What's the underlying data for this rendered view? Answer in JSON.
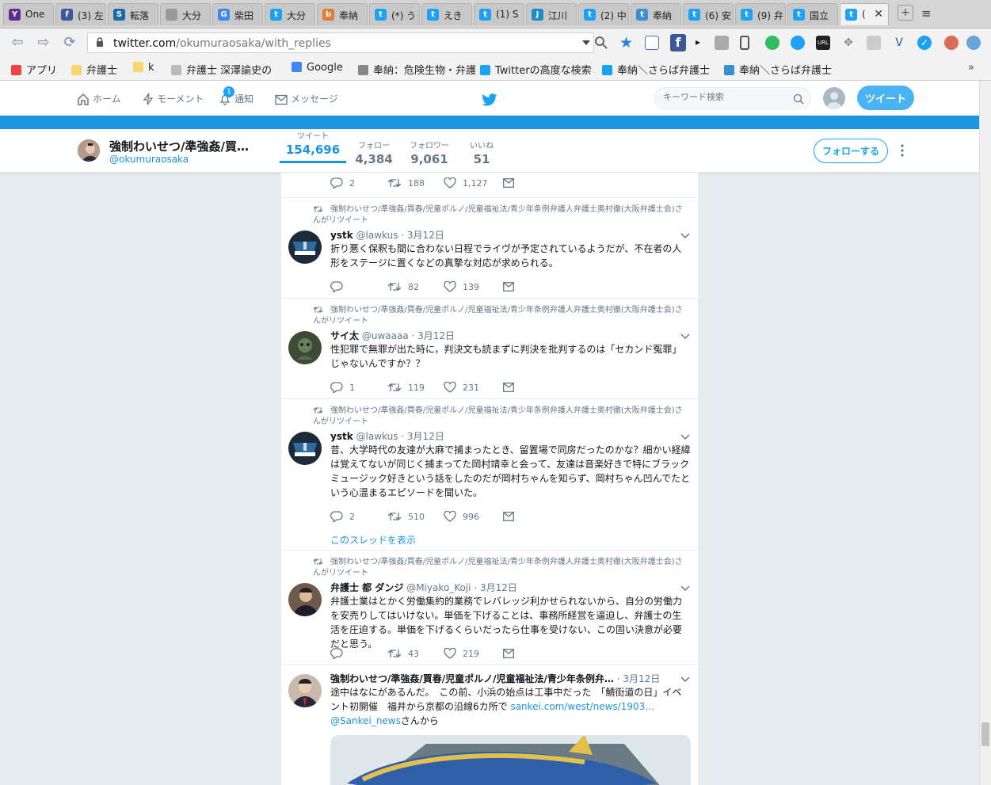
{
  "browser": {
    "tabs": [
      {
        "label": "One",
        "icon": "Y",
        "color": "#5b2d90"
      },
      {
        "label": "(3) 左",
        "icon": "f",
        "color": "#3b5998"
      },
      {
        "label": "転落",
        "icon": "S",
        "color": "#1a6aa8"
      },
      {
        "label": "大分",
        "icon": "",
        "color": "#999999"
      },
      {
        "label": "柴田",
        "icon": "G",
        "color": "#4285f4"
      },
      {
        "label": "大分",
        "icon": "t",
        "color": "#1da1f2"
      },
      {
        "label": "奉納",
        "icon": "b",
        "color": "#e07b39"
      },
      {
        "label": "(*) う",
        "icon": "t",
        "color": "#1da1f2"
      },
      {
        "label": "えき",
        "icon": "t",
        "color": "#1da1f2"
      },
      {
        "label": "(1) S",
        "icon": "t",
        "color": "#1da1f2"
      },
      {
        "label": "江川",
        "icon": "J",
        "color": "#1b8cc4"
      },
      {
        "label": "(2) 中",
        "icon": "t",
        "color": "#1da1f2"
      },
      {
        "label": "奉納",
        "icon": "t",
        "color": "#3a8fd0"
      },
      {
        "label": "(6) 安",
        "icon": "t",
        "color": "#1da1f2"
      },
      {
        "label": "(9) 弁",
        "icon": "t",
        "color": "#1da1f2"
      },
      {
        "label": "国立",
        "icon": "t",
        "color": "#1da1f2"
      },
      {
        "label": "(",
        "icon": "t",
        "color": "#1da1f2"
      }
    ],
    "url_domain": "twitter.com",
    "url_path": "/okumuraosaka/with_replies",
    "bookmarks": [
      {
        "label": "アプリ",
        "color": "#e44"
      },
      {
        "label": "弁護士",
        "color": "#f5d76e"
      },
      {
        "label": "k",
        "color": "#f5d76e"
      },
      {
        "label": "弁護士 深澤諭史の",
        "color": "#bbbbbb"
      },
      {
        "label": "Google",
        "color": "#4285f4"
      },
      {
        "label": "奉納：危険生物・弁護",
        "color": "#888888"
      },
      {
        "label": "Twitterの高度な検索",
        "color": "#1da1f2"
      },
      {
        "label": "奉納＼さらば弁護士",
        "color": "#1da1f2"
      },
      {
        "label": "奉納＼さらば弁護士",
        "color": "#3a8fd0"
      }
    ]
  },
  "twitter_nav": {
    "home": "ホーム",
    "moments": "モーメント",
    "notifications": "通知",
    "notification_count": "1",
    "messages": "メッセージ",
    "search_placeholder": "キーワード検索",
    "tweet_button": "ツイート"
  },
  "profile": {
    "name": "強制わいせつ/準強姦/買…",
    "handle": "@okumuraosaka",
    "stats": [
      {
        "label": "ツイート",
        "value": "154,696"
      },
      {
        "label": "フォロー",
        "value": "4,384"
      },
      {
        "label": "フォロワー",
        "value": "9,061"
      },
      {
        "label": "いいね",
        "value": "51"
      }
    ],
    "follow_button": "フォローする"
  },
  "timeline": {
    "top_actions": {
      "replies": "2",
      "retweets": "188",
      "likes": "1,127"
    },
    "retweet_context": "強制わいせつ/準強姦/買春/児童ポルノ/児童福祉法/青少年条例弁護人弁護士奥村徹(大阪弁護士会)さんがリツイート",
    "show_thread": "このスレッドを表示",
    "tweets": [
      {
        "name": "ystk",
        "handle": "@lawkus",
        "date": "· 3月12日",
        "text": "折り悪く保釈も間に合わない日程でライヴが予定されているようだが、不在者の人形をステージに置くなどの真摯な対応が求められる。",
        "replies": "",
        "retweets": "82",
        "likes": "139"
      },
      {
        "name": "サイ太",
        "handle": "@uwaaaa",
        "date": "· 3月12日",
        "text": "性犯罪で無罪が出た時に，判決文も読まずに判決を批判するのは「セカンド冤罪」じゃないんですか？？",
        "replies": "1",
        "retweets": "119",
        "likes": "231"
      },
      {
        "name": "ystk",
        "handle": "@lawkus",
        "date": "· 3月12日",
        "text": "昔、大学時代の友達が大麻で捕まったとき、留置場で同房だったのかな？細かい経緯は覚えてないが同じく捕まってた岡村靖幸と会って、友達は音楽好きで特にブラックミュージック好きという話をしたのだが岡村ちゃんを知らず、岡村ちゃん凹んでたという心温まるエピソードを聞いた。",
        "replies": "2",
        "retweets": "510",
        "likes": "996"
      },
      {
        "name": "弁護士 都 ダンジ",
        "handle": "@Miyako_Koji",
        "date": "· 3月12日",
        "text": "弁護士業はとかく労働集約的業務でレバレッジ利かせられないから、自分の労働力を安売りしてはいけない。単価を下げることは、事務所経営を逼迫し、弁護士の生活を圧迫する。単価を下げるくらいだったら仕事を受けない、この固い決意が必要だと思う。",
        "replies": "",
        "retweets": "43",
        "likes": "219"
      }
    ],
    "own_tweet": {
      "name": "強制わいせつ/準強姦/買春/児童ポルノ/児童福祉法/青少年条例弁…",
      "date": "· 3月12日",
      "text": "途中はなにがあるんだ。　この前、小浜の始点は工事中だった　「鯖街道の日」イベント初開催　福井から京都の沿線6カ所で ",
      "link": "sankei.com/west/news/1903…",
      "mention": "@Sankei_news",
      "suffix": "さんから"
    }
  }
}
